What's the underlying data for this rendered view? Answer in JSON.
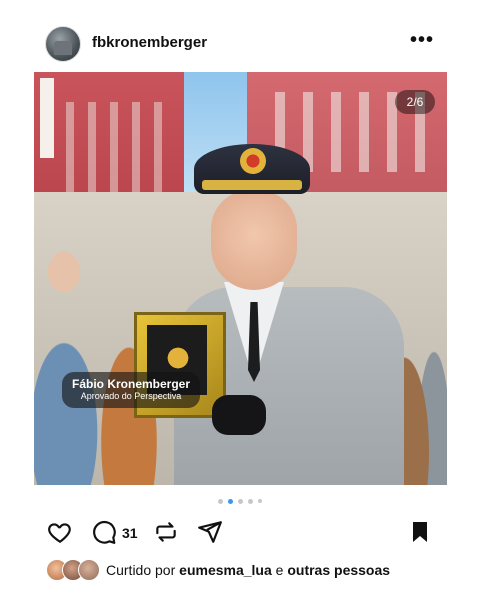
{
  "post": {
    "username": "fbkronemberger",
    "more_glyph": "•••",
    "image_counter": "2/6",
    "overlay": {
      "name": "Fábio Kronemberger",
      "subtitle": "Aprovado do Perspectiva"
    },
    "carousel": {
      "total_dots": 5,
      "active_index": 1
    }
  },
  "actions": {
    "like_icon": "heart-icon",
    "comment_icon": "comment-icon",
    "comment_count": "31",
    "repost_icon": "repost-icon",
    "share_icon": "paper-plane-icon",
    "save_icon": "bookmark-icon"
  },
  "likes": {
    "prefix": "Curtido por",
    "user": "eumesma_lua",
    "connector": "e",
    "others": "outras pessoas"
  },
  "colors": {
    "accent": "#3897f0",
    "text": "#111111"
  }
}
